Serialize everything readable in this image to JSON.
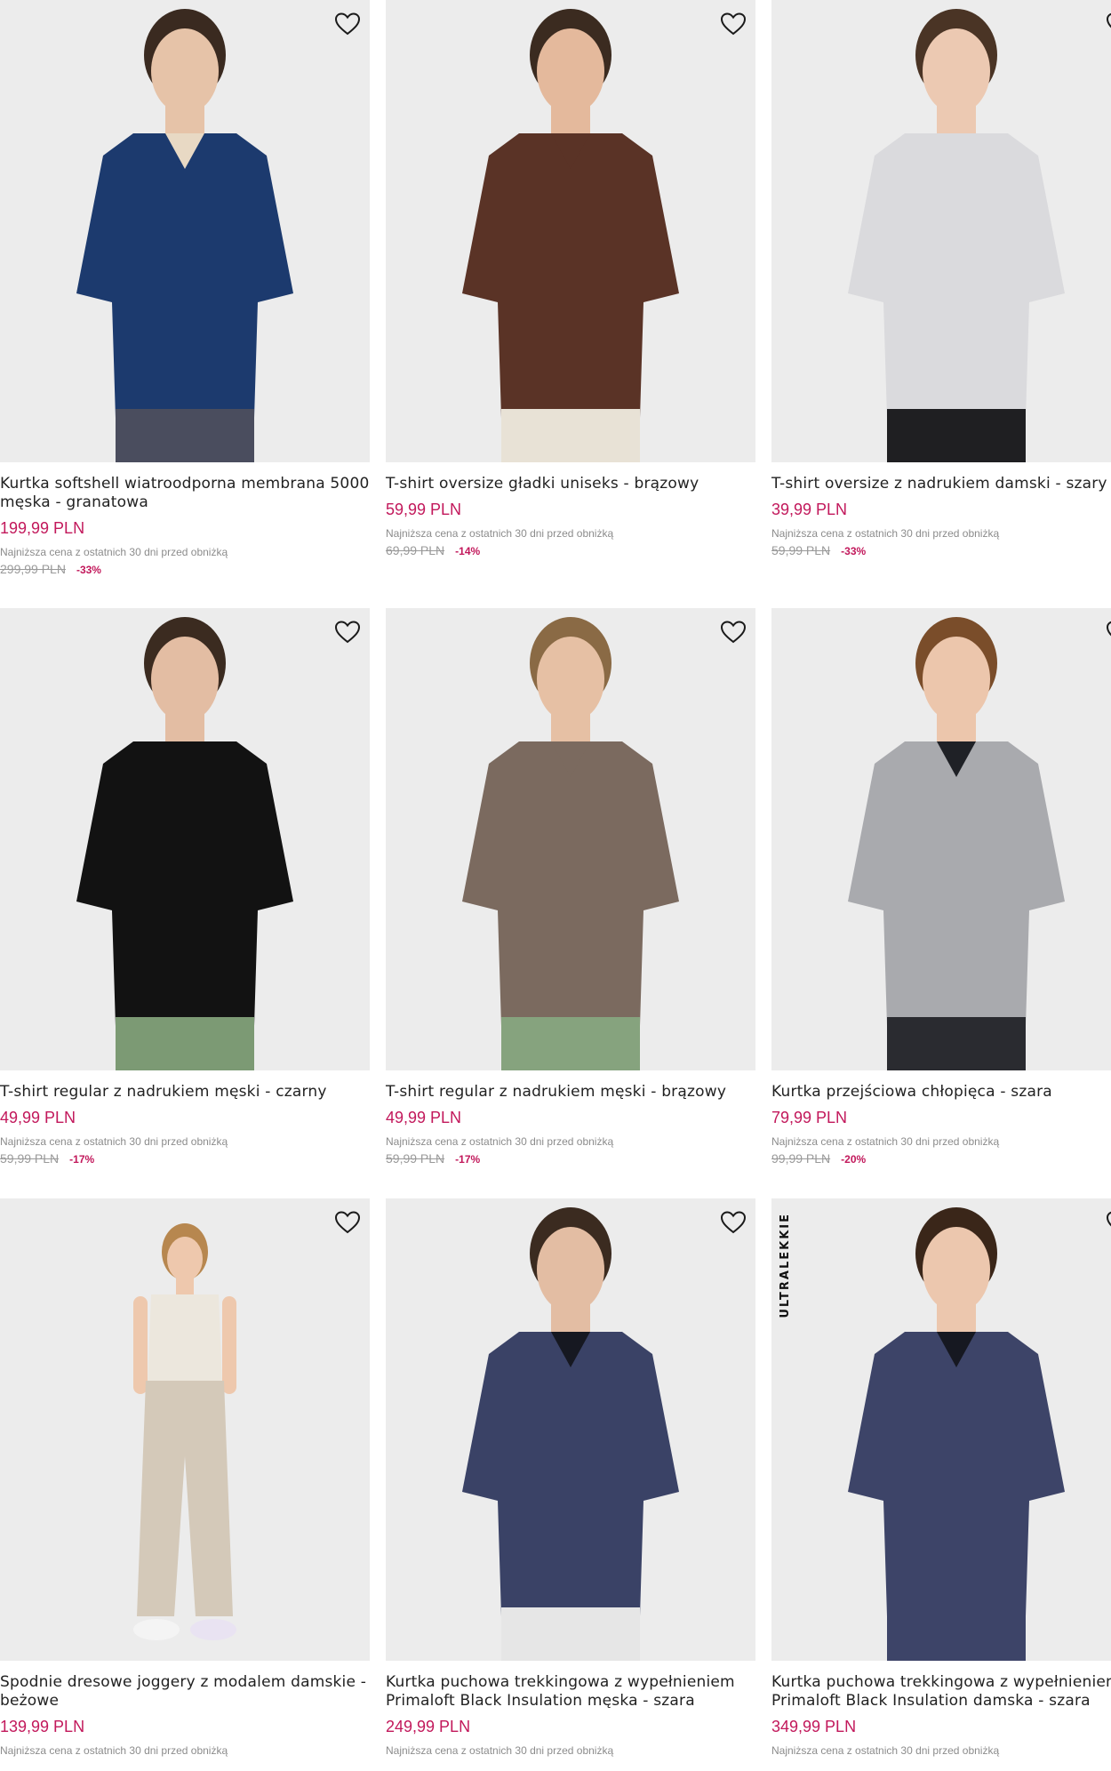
{
  "products": [
    {
      "name": "Kurtka softshell wiatroodporna membrana 5000 męska - granatowa",
      "price": "199,99 PLN",
      "lowest_note": "Najniższa cena z ostatnich 30 dni przed obniżką",
      "old_price": "299,99 PLN",
      "discount": "-33%",
      "colors": {
        "top": "#1c3a6e",
        "inner": "#e8d9c4",
        "bottom": "#4a4d5e",
        "skin": "#e6c3a8",
        "hair": "#3a2a20"
      }
    },
    {
      "name": "T-shirt oversize gładki uniseks - brązowy",
      "price": "59,99 PLN",
      "lowest_note": "Najniższa cena z ostatnich 30 dni przed obniżką",
      "old_price": "69,99 PLN",
      "discount": "-14%",
      "colors": {
        "top": "#5a3326",
        "inner": "#5a3326",
        "bottom": "#e8e2d6",
        "skin": "#e4b99c",
        "hair": "#3b2b20"
      }
    },
    {
      "name": "T-shirt oversize z nadrukiem damski - szary",
      "price": "39,99 PLN",
      "lowest_note": "Najniższa cena z ostatnich 30 dni przed obniżką",
      "old_price": "59,99 PLN",
      "discount": "-33%",
      "colors": {
        "top": "#dadadd",
        "inner": "#dadadd",
        "bottom": "#1f1f22",
        "skin": "#ecc9b2",
        "hair": "#4a3425"
      }
    },
    {
      "name": "T-shirt regular z nadrukiem męski - czarny",
      "price": "49,99 PLN",
      "lowest_note": "Najniższa cena z ostatnich 30 dni przed obniżką",
      "old_price": "59,99 PLN",
      "discount": "-17%",
      "colors": {
        "top": "#121212",
        "inner": "#121212",
        "bottom": "#7c9a74",
        "skin": "#e3bda3",
        "hair": "#3b2b20"
      }
    },
    {
      "name": "T-shirt regular z nadrukiem męski - brązowy",
      "price": "49,99 PLN",
      "lowest_note": "Najniższa cena z ostatnich 30 dni przed obniżką",
      "old_price": "59,99 PLN",
      "discount": "-17%",
      "colors": {
        "top": "#7b6a5f",
        "inner": "#7b6a5f",
        "bottom": "#86a37e",
        "skin": "#e6c0a4",
        "hair": "#8a6a45"
      }
    },
    {
      "name": "Kurtka przejściowa chłopięca - szara",
      "price": "79,99 PLN",
      "lowest_note": "Najniższa cena z ostatnich 30 dni przed obniżką",
      "old_price": "99,99 PLN",
      "discount": "-20%",
      "colors": {
        "top": "#a9aaae",
        "inner": "#1f2126",
        "bottom": "#2a2b30",
        "skin": "#ecc6ac",
        "hair": "#7a4d2a"
      }
    },
    {
      "name": "Spodnie dresowe joggery z modalem damskie - beżowe",
      "price": "139,99 PLN",
      "lowest_note": "Najniższa cena z ostatnich 30 dni przed obniżką",
      "old_price": "",
      "discount": "",
      "colors": {
        "top": "#ece7dd",
        "inner": "#ece7dd",
        "bottom": "#d4c9b9",
        "skin": "#eec8ad",
        "hair": "#b7874f"
      }
    },
    {
      "name": "Kurtka puchowa trekkingowa z wypełnieniem Primaloft Black Insulation męska - szara",
      "price": "249,99 PLN",
      "lowest_note": "Najniższa cena z ostatnich 30 dni przed obniżką",
      "old_price": "",
      "discount": "",
      "colors": {
        "top": "#3a4266",
        "inner": "#161821",
        "bottom": "#e6e6e6",
        "skin": "#e3bda3",
        "hair": "#3b2b20"
      }
    },
    {
      "name": "Kurtka puchowa trekkingowa z wypełnieniem Primaloft Black Insulation damska - szara",
      "price": "349,99 PLN",
      "lowest_note": "Najniższa cena z ostatnich 30 dni przed obniżką",
      "old_price": "",
      "discount": "",
      "badge": "ULTRALEKKIE",
      "colors": {
        "top": "#3d4468",
        "inner": "#161821",
        "bottom": "#3d4468",
        "skin": "#ecc7ae",
        "hair": "#3a2619"
      }
    }
  ],
  "icons": {
    "favorite": "heart-outline-icon"
  }
}
